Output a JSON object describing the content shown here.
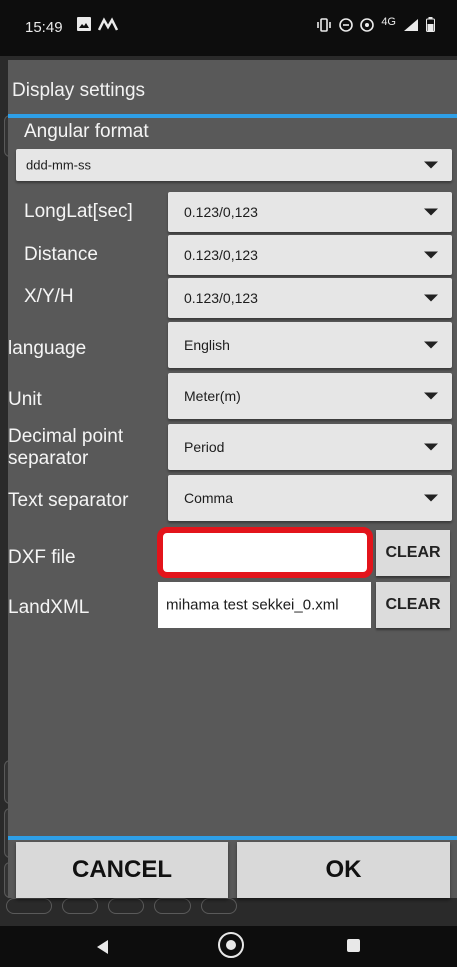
{
  "status_bar": {
    "time": "15:49",
    "network": "4G"
  },
  "dialog": {
    "title": "Display settings",
    "angular_format": {
      "label": "Angular format",
      "value": "ddd-mm-ss"
    },
    "rows": {
      "longlat": {
        "label": "LongLat[sec]",
        "value": "0.123/0,123"
      },
      "distance": {
        "label": "Distance",
        "value": "0.123/0,123"
      },
      "xyh": {
        "label": "X/Y/H",
        "value": "0.123/0,123"
      },
      "language": {
        "label": "language",
        "value": "English"
      },
      "unit": {
        "label": "Unit",
        "value": "Meter(m)"
      },
      "decimal": {
        "label_line1": "Decimal point",
        "label_line2": "separator",
        "value": "Period"
      },
      "text_sep": {
        "label": "Text separator",
        "value": "Comma"
      }
    },
    "dxf": {
      "label": "DXF file",
      "value": "",
      "clear": "CLEAR"
    },
    "landxml": {
      "label": "LandXML",
      "value": "mihama test sekkei_0.xml",
      "clear": "CLEAR"
    },
    "cancel": "CANCEL",
    "ok": "OK"
  },
  "colors": {
    "accent": "#2e9fe7",
    "highlight": "#e3141b",
    "dialog_bg": "#595959"
  }
}
